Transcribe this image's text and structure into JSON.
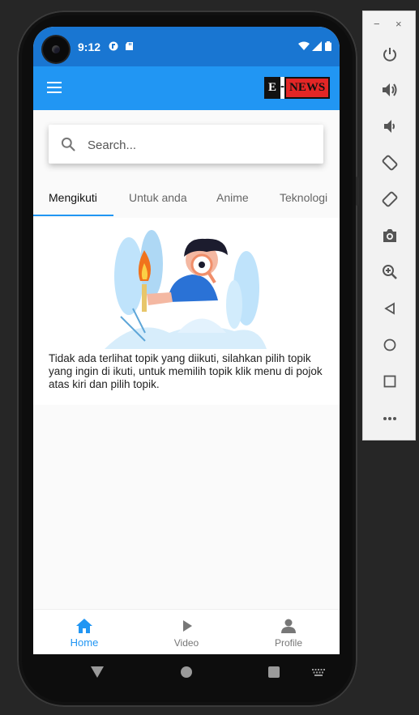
{
  "status": {
    "time": "9:12"
  },
  "appbar": {
    "logo_e": "E",
    "logo_dash": "-",
    "logo_news": "NEWS"
  },
  "search": {
    "placeholder": "Search..."
  },
  "tabs": [
    {
      "label": "Mengikuti"
    },
    {
      "label": "Untuk anda"
    },
    {
      "label": "Anime"
    },
    {
      "label": "Teknologi"
    }
  ],
  "main": {
    "empty_message": "Tidak ada terlihat topik yang diikuti, silahkan pilih topik yang ingin di ikuti, untuk memilih topik klik menu di pojok atas kiri dan pilih topik."
  },
  "bottom_nav": [
    {
      "label": "Home",
      "icon": "home-icon"
    },
    {
      "label": "Video",
      "icon": "play-icon"
    },
    {
      "label": "Profile",
      "icon": "person-icon"
    }
  ],
  "colors": {
    "primary": "#2196f3",
    "status_bar": "#1976d2",
    "logo_red": "#e32626"
  }
}
